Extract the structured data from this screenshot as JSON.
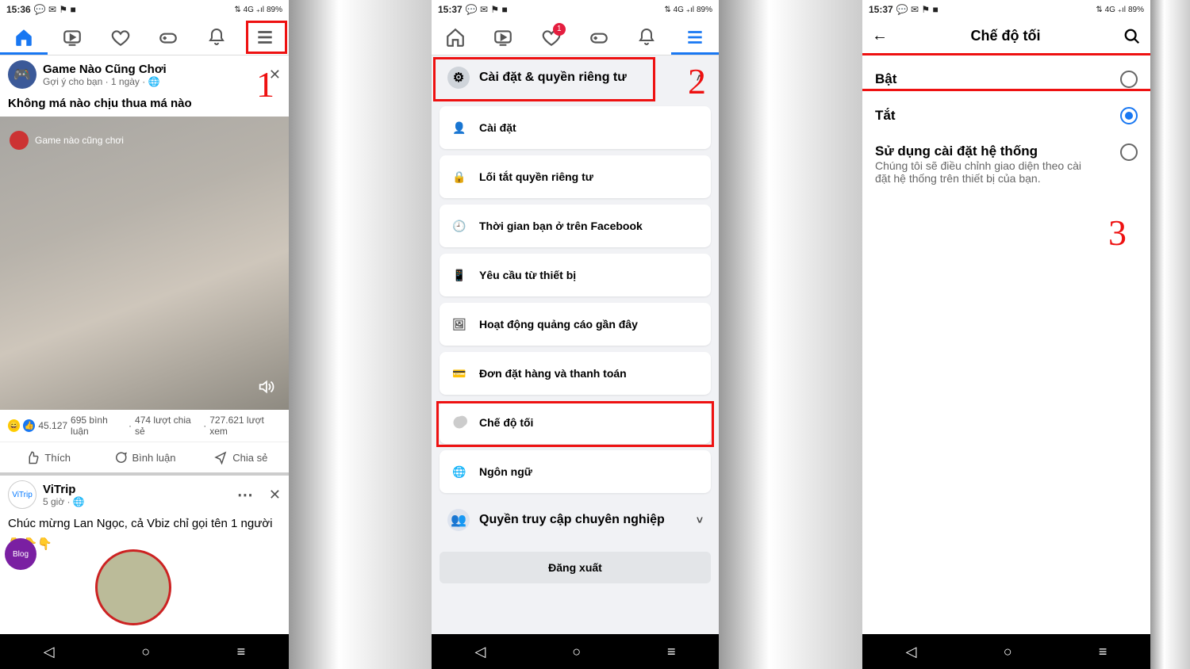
{
  "status": {
    "time1": "15:36",
    "time2": "15:37",
    "time3": "15:37",
    "battery": "89%",
    "net_label": "4G"
  },
  "steps": {
    "s1": "1",
    "s2": "2",
    "s3": "3"
  },
  "p1": {
    "tabs_badge": "1",
    "post1": {
      "name": "Game Nào Cũng Chơi",
      "sub": "Gợi ý cho bạn · 1 ngày · 🌐",
      "text": "Không má nào chịu thua má nào",
      "overlay_name": "Game nào cũng chơi",
      "reactions": "45.127",
      "comments": "695 bình luận",
      "shares": "474 lượt chia sẻ",
      "views": "727.621 lượt xem"
    },
    "actions": {
      "like": "Thích",
      "comment": "Bình luận",
      "share": "Chia sẻ"
    },
    "post2": {
      "name": "ViTrip",
      "sub": "5 giờ · 🌐",
      "text": "Chúc mừng Lan Ngọc, cả Vbiz chỉ gọi tên 1 người",
      "emojis": "👇👇👇"
    }
  },
  "p2": {
    "group_header": "Cài đặt & quyền riêng tư",
    "items": [
      "Cài đặt",
      "Lối tắt quyền riêng tư",
      "Thời gian bạn ở trên Facebook",
      "Yêu cầu từ thiết bị",
      "Hoạt động quảng cáo gần đây",
      "Đơn đặt hàng và thanh toán",
      "Chế độ tối",
      "Ngôn ngữ"
    ],
    "group2": "Quyền truy cập chuyên nghiệp",
    "logout": "Đăng xuất"
  },
  "p3": {
    "title": "Chế độ tối",
    "opt_on": "Bật",
    "opt_off": "Tắt",
    "opt_sys": "Sử dụng cài đặt hệ thống",
    "opt_sys_sub": "Chúng tôi sẽ điều chỉnh giao diện theo cài đặt hệ thống trên thiết bị của bạn."
  }
}
